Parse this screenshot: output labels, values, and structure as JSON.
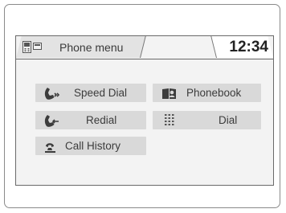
{
  "header": {
    "title": "Phone menu",
    "clock": "12:34",
    "phone_icon": "phone-status-icon"
  },
  "menu": {
    "speed_dial": {
      "label": "Speed Dial",
      "icon": "speed-dial-handset-icon"
    },
    "phonebook": {
      "label": "Phonebook",
      "icon": "phonebook-icon"
    },
    "redial": {
      "label": "Redial",
      "icon": "redial-handset-icon"
    },
    "dial": {
      "label": "Dial",
      "icon": "dialpad-icon"
    },
    "call_history": {
      "label": "Call History",
      "icon": "call-history-icon"
    }
  },
  "colors": {
    "button_bg": "#d9d9d9",
    "screen_bg": "#f3f3f3",
    "title_tab_bg": "#e3e3e3",
    "text": "#3a3a3a"
  }
}
